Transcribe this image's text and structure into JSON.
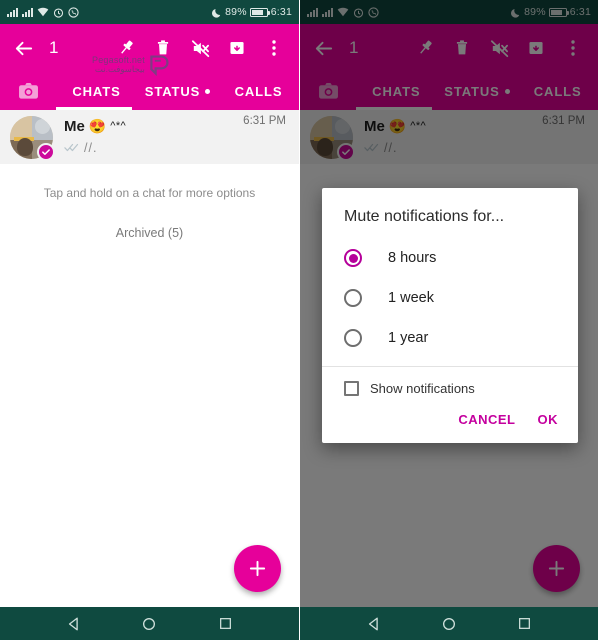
{
  "theme": {
    "accent": "#e6009a",
    "accent_dark": "#b5009a",
    "statusbar_bg": "#10483f",
    "navbar_bg": "#0f4a40",
    "dialog_action_color": "#c4009e"
  },
  "status_bar": {
    "icons": [
      "signal-icon",
      "signal-icon",
      "wifi-icon",
      "alarm-icon",
      "whatsapp-icon"
    ],
    "do_not_disturb_icon": "moon-icon",
    "battery_percent": "89%",
    "battery_icon": "battery-icon",
    "clock": "6:31"
  },
  "app_bar": {
    "back_icon": "back-arrow-icon",
    "selected_count": "1",
    "actions": [
      {
        "name": "pin-icon",
        "label": "Pin"
      },
      {
        "name": "delete-icon",
        "label": "Delete"
      },
      {
        "name": "mute-icon",
        "label": "Mute"
      },
      {
        "name": "archive-icon",
        "label": "Archive"
      },
      {
        "name": "overflow-menu-icon",
        "label": "More options"
      }
    ]
  },
  "tabs": {
    "camera_icon": "camera-icon",
    "items": [
      {
        "label": "CHATS",
        "active": true,
        "dot": false
      },
      {
        "label": "STATUS",
        "active": false,
        "dot": true
      },
      {
        "label": "CALLS",
        "active": false,
        "dot": false
      }
    ]
  },
  "watermark": {
    "latin": "Pegasoft.net",
    "arabic": "بيجاسوفت.نت",
    "logo": "pegasoft-logo-icon"
  },
  "chat_list": {
    "rows": [
      {
        "name": "Me",
        "emoji": "😍",
        "suffix": "^*^",
        "message": "//.",
        "time": "6:31 PM",
        "selected": true,
        "avatar": "contact-avatar",
        "badge_icon": "check-badge-icon"
      }
    ],
    "hint": "Tap and hold on a chat for more options",
    "archived": "Archived (5)"
  },
  "fab": {
    "icon": "plus-icon",
    "label": "New chat"
  },
  "nav_bar": {
    "buttons": [
      {
        "name": "nav-back-icon",
        "label": "Back"
      },
      {
        "name": "nav-home-icon",
        "label": "Home"
      },
      {
        "name": "nav-recents-icon",
        "label": "Recents"
      }
    ]
  },
  "dialog": {
    "title": "Mute notifications for...",
    "options": [
      {
        "label": "8 hours",
        "selected": true
      },
      {
        "label": "1 week",
        "selected": false
      },
      {
        "label": "1 year",
        "selected": false
      }
    ],
    "checkbox": {
      "label": "Show notifications",
      "checked": false
    },
    "cancel_label": "CANCEL",
    "ok_label": "OK"
  }
}
